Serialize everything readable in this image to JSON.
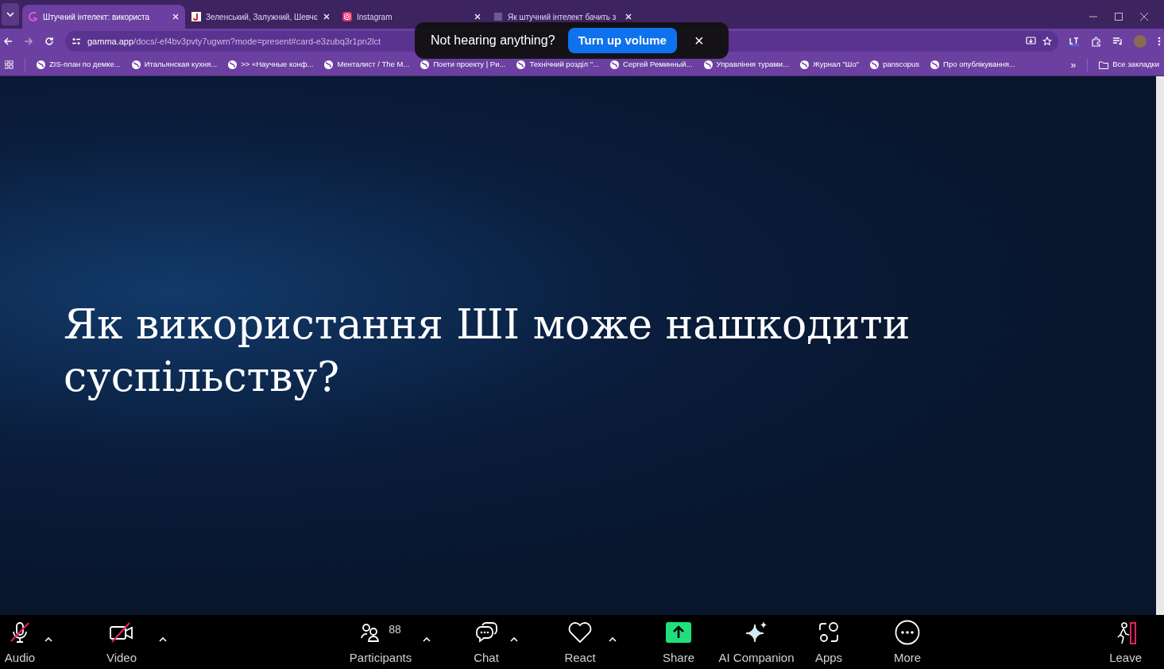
{
  "browser": {
    "tabs": [
      {
        "title": "Штучний інтелект: використа",
        "selected": true
      },
      {
        "title": "Зеленський, Залужний, Шевчє",
        "selected": false
      },
      {
        "title": "Instagram",
        "selected": false
      },
      {
        "title": "Як штучний інтелект бачить з",
        "selected": false
      }
    ],
    "url_host": "gamma.app",
    "url_path": "/docs/-ef4bv3pvty7ugwm?mode=present#card-e3zubq3r1pn2lct",
    "bookmarks": [
      "ZIS-план по демке...",
      "Итальянская кухня...",
      ">> «Научные конф...",
      "Менталист / The M...",
      "Поети проекту | Ри...",
      "Технічний розділ \"...",
      "Сергей Реминный...",
      "Управління турами...",
      "Журнал \"Шо\"",
      "panscopus",
      "Про опублікування..."
    ],
    "all_bookmarks": "Все закладки",
    "more_bookmarks": "»"
  },
  "popup": {
    "message": "Not hearing anything?",
    "button": "Turn up volume",
    "close": "×"
  },
  "slide": {
    "heading": "Як використання ШІ може нашкодити суспільству?"
  },
  "toolbar": {
    "items": [
      {
        "kind": "audio",
        "label": "Audio",
        "muted": true,
        "caret": true
      },
      {
        "kind": "video",
        "label": "Video",
        "muted": true,
        "caret": true
      },
      {
        "kind": "participants",
        "label": "Participants",
        "count": "88",
        "caret": true
      },
      {
        "kind": "chat",
        "label": "Chat",
        "caret": true
      },
      {
        "kind": "react",
        "label": "React",
        "caret": true
      },
      {
        "kind": "share",
        "label": "Share",
        "caret": false
      },
      {
        "kind": "ai",
        "label": "AI Companion",
        "caret": false
      },
      {
        "kind": "apps",
        "label": "Apps",
        "caret": false
      },
      {
        "kind": "more",
        "label": "More",
        "caret": false
      }
    ],
    "leave": "Leave"
  }
}
